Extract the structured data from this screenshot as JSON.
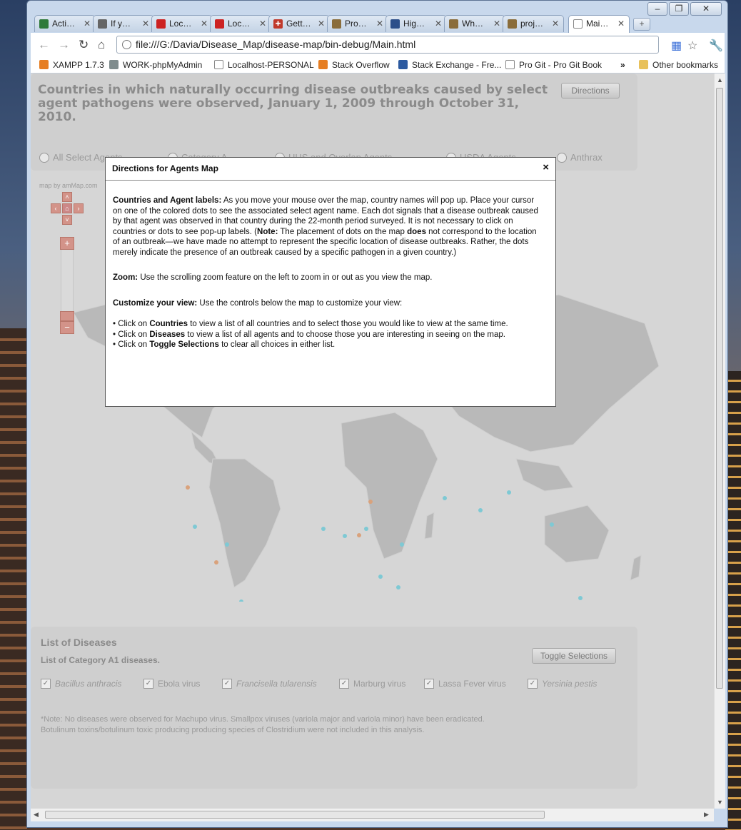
{
  "browser": {
    "tabs": [
      {
        "label": "Acti…",
        "icon_color": "#2f7a3a"
      },
      {
        "label": "If y…",
        "icon_color": "#666666"
      },
      {
        "label": "Loc…",
        "icon_color": "#cc2222"
      },
      {
        "label": "Loc…",
        "icon_color": "#cc2222"
      },
      {
        "label": "Gett…",
        "icon_color": "#c0392b"
      },
      {
        "label": "Pro…",
        "icon_color": "#8a6d3b"
      },
      {
        "label": "Hig…",
        "icon_color": "#2c4f8a"
      },
      {
        "label": "Wh…",
        "icon_color": "#8a6d3b"
      },
      {
        "label": "proj…",
        "icon_color": "#8a6d3b"
      },
      {
        "label": "Mai…",
        "icon_color": "#dddddd"
      }
    ],
    "url": "file:///G:/Davia/Disease_Map/disease-map/bin-debug/Main.html",
    "bookmarks": [
      {
        "label": "XAMPP 1.7.3",
        "icon_color": "#e67e22"
      },
      {
        "label": "WORK-phpMyAdmin",
        "icon_color": "#7f8c8d"
      },
      {
        "label": "Localhost-PERSONAL",
        "icon_color": "#dddddd"
      },
      {
        "label": "Stack Overflow",
        "icon_color": "#e67e22"
      },
      {
        "label": "Stack Exchange - Fre...",
        "icon_color": "#2c5aa0"
      },
      {
        "label": "Pro Git - Pro Git Book",
        "icon_color": "#dddddd"
      }
    ],
    "bookmarks_overflow": "»",
    "other_bookmarks": "Other bookmarks"
  },
  "header": {
    "title": "Countries in which naturally occurring disease outbreaks caused by select agent pathogens were observed, January 1, 2009 through October 31, 2010.",
    "directions_button": "Directions",
    "radios": [
      "All Select Agents",
      "Category A",
      "HHS and Overlap Agents",
      "USDA Agents",
      "Anthrax"
    ]
  },
  "map": {
    "credit": "map by amMap.com"
  },
  "modal": {
    "title": "Directions for Agents Map",
    "close": "×",
    "s1_heading": "Countries and Agent labels:",
    "s1_text_a": " As you move your mouse over the map, country names will pop up. Place your cursor on one of the colored dots to see the associated select agent name. Each dot signals that a disease outbreak caused by that agent was observed in that country during the 22-month period surveyed. It is not necessary to click on countries or dots to see pop-up labels. (",
    "s1_note": "Note:",
    "s1_text_b": " The placement of dots on the map ",
    "s1_does": "does",
    "s1_text_c": " not correspond to the location of an outbreak—we have made no attempt to represent the specific location of disease outbreaks. Rather, the dots merely indicate the presence of an outbreak caused by a specific pathogen in a given country.)",
    "s2_heading": "Zoom:",
    "s2_text": " Use the scrolling zoom feature on the left to zoom in or out as you view the map.",
    "s3_heading": "Customize your view:",
    "s3_text": " Use the controls below the map to customize your view:",
    "bullets": [
      {
        "pre": "• Click on ",
        "bold": "Countries",
        "post": " to view a list of all countries and to select those you would like to view at the same time."
      },
      {
        "pre": "• Click on ",
        "bold": "Diseases",
        "post": " to view a list of all agents and to choose those you are interesting in seeing on the map."
      },
      {
        "pre": "• Click on ",
        "bold": "Toggle Selections",
        "post": " to clear all choices in either list."
      }
    ]
  },
  "diseases": {
    "title": "List of Diseases",
    "subtitle": "List of Category A1 diseases.",
    "toggle_button": "Toggle Selections",
    "items": [
      {
        "label": "Bacillus anthracis",
        "italic": true,
        "checked": true
      },
      {
        "label": "Ebola virus",
        "italic": false,
        "checked": true
      },
      {
        "label": "Francisella tularensis",
        "italic": true,
        "checked": true
      },
      {
        "label": "Marburg virus",
        "italic": false,
        "checked": true
      },
      {
        "label": "Lassa Fever virus",
        "italic": false,
        "checked": true
      },
      {
        "label": "Yersinia pestis",
        "italic": true,
        "checked": true
      }
    ],
    "note": "*Note: No diseases were observed for Machupo virus.  Smallpox viruses (variola major and variola minor) have been eradicated. Botulinum toxins/botulinum toxic producing producing species of Clostridium were not included in this analysis."
  }
}
